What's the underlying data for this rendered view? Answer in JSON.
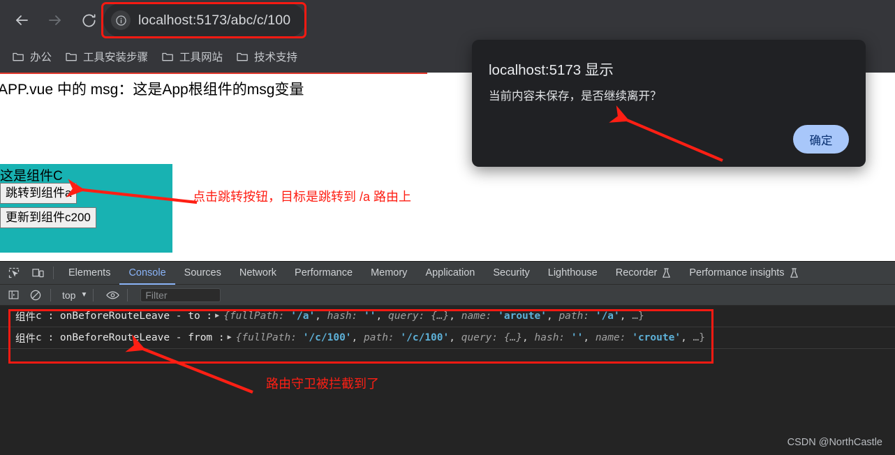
{
  "browser": {
    "nav": {
      "back_icon": "arrow-left-icon",
      "forward_icon": "arrow-right-icon",
      "reload_icon": "reload-icon"
    },
    "omnibox": {
      "info_icon": "site-info-icon",
      "url_host": "localhost:5173",
      "url_path": "/abc/c/100",
      "full_url": "localhost:5173/abc/c/100"
    },
    "bookmarks": [
      {
        "icon": "folder-icon",
        "label": "办公"
      },
      {
        "icon": "folder-icon",
        "label": "工具安装步骤"
      },
      {
        "icon": "folder-icon",
        "label": "工具网站"
      },
      {
        "icon": "folder-icon",
        "label": "技术支持"
      }
    ]
  },
  "page": {
    "app_msg": "APP.vue 中的 msg：这是App根组件的msg变量",
    "component_c": {
      "title": "这是组件C",
      "buttons": [
        {
          "label": "跳转到组件a"
        },
        {
          "label": "更新到组件c200"
        }
      ],
      "bg_color": "#18b2b2"
    }
  },
  "dialog": {
    "title": "localhost:5173 显示",
    "message": "当前内容未保存，是否继续离开？",
    "ok_label": "确定",
    "button_color": "#a8c7fa",
    "bg_color": "#202124"
  },
  "devtools": {
    "toolbar_icons": [
      {
        "name": "inspect-element-icon"
      },
      {
        "name": "device-toolbar-icon"
      }
    ],
    "tabs": [
      {
        "label": "Elements",
        "active": false,
        "beaker": false
      },
      {
        "label": "Console",
        "active": true,
        "beaker": false
      },
      {
        "label": "Sources",
        "active": false,
        "beaker": false
      },
      {
        "label": "Network",
        "active": false,
        "beaker": false
      },
      {
        "label": "Performance",
        "active": false,
        "beaker": false
      },
      {
        "label": "Memory",
        "active": false,
        "beaker": false
      },
      {
        "label": "Application",
        "active": false,
        "beaker": false
      },
      {
        "label": "Security",
        "active": false,
        "beaker": false
      },
      {
        "label": "Lighthouse",
        "active": false,
        "beaker": false
      },
      {
        "label": "Recorder",
        "active": false,
        "beaker": true
      },
      {
        "label": "Performance insights",
        "active": false,
        "beaker": true
      }
    ],
    "active_tab": "Console",
    "accent_color": "#8ab4f8",
    "subbar": {
      "sidebar_icon": "console-sidebar-icon",
      "clear_icon": "clear-console-icon",
      "context": "top",
      "caret": "▼",
      "eye_icon": "live-expression-icon",
      "filter_placeholder": "Filter"
    },
    "console_logs": [
      {
        "prefix_zh": "组件",
        "prefix_mono": "c : onBeforeRouteLeave - to : ",
        "triangle": "▶",
        "object": [
          {
            "t": "brace",
            "v": "{"
          },
          {
            "t": "key",
            "v": "fullPath: "
          },
          {
            "t": "str",
            "v": "'/a'"
          },
          {
            "t": "punc",
            "v": ", "
          },
          {
            "t": "key",
            "v": "hash: "
          },
          {
            "t": "str",
            "v": "''"
          },
          {
            "t": "punc",
            "v": ", "
          },
          {
            "t": "key",
            "v": "query: "
          },
          {
            "t": "brace",
            "v": "{…}"
          },
          {
            "t": "punc",
            "v": ", "
          },
          {
            "t": "key",
            "v": "name: "
          },
          {
            "t": "str",
            "v": "'aroute'"
          },
          {
            "t": "punc",
            "v": ", "
          },
          {
            "t": "key",
            "v": "path: "
          },
          {
            "t": "str",
            "v": "'/a'"
          },
          {
            "t": "punc",
            "v": ", "
          },
          {
            "t": "ell",
            "v": "…}"
          }
        ]
      },
      {
        "prefix_zh": "组件",
        "prefix_mono": "c : onBeforeRouteLeave - from : ",
        "triangle": "▶",
        "object": [
          {
            "t": "brace",
            "v": "{"
          },
          {
            "t": "key",
            "v": "fullPath: "
          },
          {
            "t": "str",
            "v": "'/c/100'"
          },
          {
            "t": "punc",
            "v": ", "
          },
          {
            "t": "key",
            "v": "path: "
          },
          {
            "t": "str",
            "v": "'/c/100'"
          },
          {
            "t": "punc",
            "v": ", "
          },
          {
            "t": "key",
            "v": "query: "
          },
          {
            "t": "brace",
            "v": "{…}"
          },
          {
            "t": "punc",
            "v": ", "
          },
          {
            "t": "key",
            "v": "hash: "
          },
          {
            "t": "str",
            "v": "''"
          },
          {
            "t": "punc",
            "v": ", "
          },
          {
            "t": "key",
            "v": "name: "
          },
          {
            "t": "str",
            "v": "'croute'"
          },
          {
            "t": "punc",
            "v": ", "
          },
          {
            "t": "ell",
            "v": "…}"
          }
        ]
      }
    ]
  },
  "annotations": {
    "color": "#fe1f14",
    "click_jump": "点击跳转按钮，目标是跳转到 /a 路由上",
    "guard": "路由守卫被拦截到了"
  },
  "watermark": "CSDN @NorthCastle"
}
